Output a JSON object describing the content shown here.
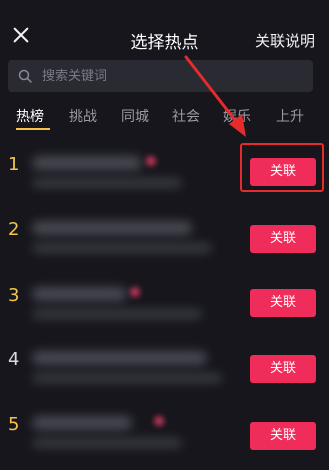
{
  "header": {
    "title": "选择热点",
    "explain_label": "关联说明"
  },
  "search": {
    "placeholder": "搜索关键词"
  },
  "tabs": [
    {
      "label": "热榜",
      "active": true
    },
    {
      "label": "挑战"
    },
    {
      "label": "同城"
    },
    {
      "label": "社会"
    },
    {
      "label": "娱乐"
    },
    {
      "label": "上升"
    }
  ],
  "list": [
    {
      "rank": "1",
      "button": "关联"
    },
    {
      "rank": "2",
      "button": "关联"
    },
    {
      "rank": "3",
      "button": "关联"
    },
    {
      "rank": "4",
      "button": "关联"
    },
    {
      "rank": "5",
      "button": "关联"
    }
  ],
  "colors": {
    "accent": "#f02d5a",
    "rank_top": "#f4c54a",
    "annotation": "#e52b2b",
    "background": "#16161c"
  }
}
